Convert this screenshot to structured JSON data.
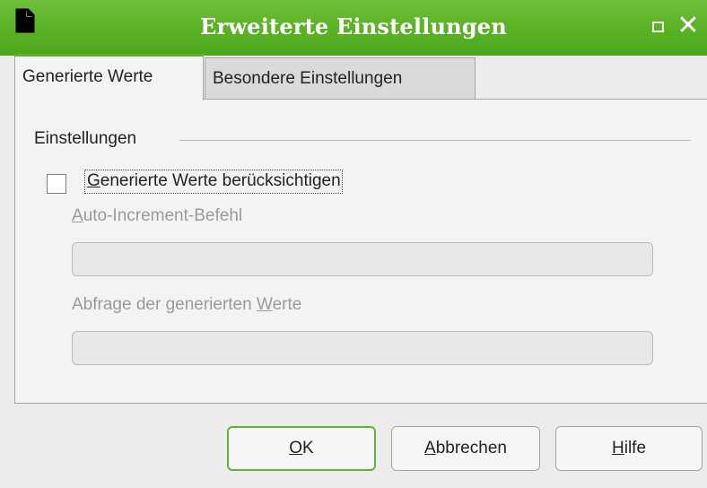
{
  "window": {
    "title": "Erweiterte Einstellungen",
    "accent_color": "#5ab124",
    "app_icon": "document-icon",
    "close_glyph": "✕"
  },
  "tabs": [
    {
      "label": "Generierte Werte",
      "active": true
    },
    {
      "label": "Besondere Einstellungen",
      "active": false
    }
  ],
  "group": {
    "label": "Einstellungen"
  },
  "checkbox": {
    "checked": false,
    "label_mnemonic": "G",
    "label_rest": "enerierte Werte berücksichtigen"
  },
  "fields": [
    {
      "label_mnemonic": "A",
      "label_rest": "uto-Increment-Befehl",
      "value": "",
      "enabled": false
    },
    {
      "label_before": "Abfrage der generierten ",
      "label_mnemonic": "W",
      "label_after": "erte",
      "value": "",
      "enabled": false
    }
  ],
  "buttons": {
    "ok": {
      "mnemonic": "O",
      "rest": "K"
    },
    "cancel": {
      "mnemonic": "A",
      "rest": "bbrechen"
    },
    "help": {
      "mnemonic": "H",
      "rest": "ilfe"
    }
  }
}
